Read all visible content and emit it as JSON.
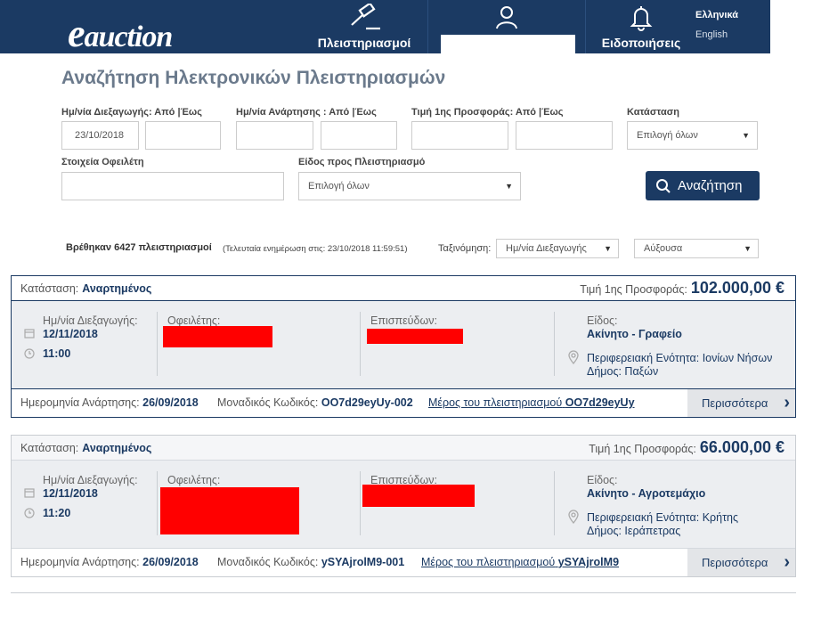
{
  "header": {
    "logo": "eauction",
    "logo_e": "e",
    "logo_rest": "auction",
    "nav_auctions": "Πλειστηριασμοί",
    "nav_notifications": "Ειδοποιήσεις",
    "lang_el": "Ελληνικά",
    "lang_en": "English",
    "icons": [
      "gavel-icon",
      "user-icon",
      "bell-icon"
    ]
  },
  "search": {
    "title": "Αναζήτηση Ηλεκτρονικών Πλειστηριασμών",
    "label_auction_date": "Ημ/νία Διεξαγωγής: Από |Έως",
    "auction_date_from": "23/10/2018",
    "auction_date_to": "",
    "label_post_date": "Ημ/νία Ανάρτησης : Από |Έως",
    "post_date_from": "",
    "post_date_to": "",
    "label_first_offer": "Τιμή 1ης Προσφοράς: Από |Έως",
    "first_offer_from": "",
    "first_offer_to": "",
    "label_status": "Κατάσταση",
    "status_value": "Επιλογή όλων",
    "label_debtor": "Στοιχεία Οφειλέτη",
    "debtor_value": "",
    "label_kind": "Είδος προς Πλειστηριασμό",
    "kind_value": "Επιλογή όλων",
    "search_button": "Αναζήτηση"
  },
  "results": {
    "found": "Βρέθηκαν 6427 πλειστηριασμοί",
    "updated": "(Τελευταία ενημέρωση στις: 23/10/2018 11:59:51)",
    "sort_label": "Ταξινόμηση:",
    "sort_by": "Ημ/νία Διεξαγωγής",
    "sort_order": "Αύξουσα"
  },
  "labels": {
    "status": "Κατάσταση:",
    "first_offer": "Τιμή 1ης Προσφοράς:",
    "auction_date": "Ημ/νία Διεξαγωγής:",
    "debtor": "Οφειλέτης:",
    "pursuer": "Επισπεύδων:",
    "kind": "Είδος:",
    "post_date": "Ημερομηνία Ανάρτησης:",
    "unique_code": "Μοναδικός Κωδικός:",
    "part_of": "Μέρος του πλειστηριασμού",
    "more": "Περισσότερα"
  },
  "cards": [
    {
      "status": "Αναρτημένος",
      "price": "102.000,00 €",
      "date": "12/11/2018",
      "time": "11:00",
      "kind": "Ακίνητο - Γραφείο",
      "region": "Περιφερειακή Ενότητα: Ιονίων Νήσων",
      "municipality": "Δήμος: Παξών",
      "post_date": "26/09/2018",
      "code": "OO7d29eyUy-002",
      "parent_code": "OO7d29eyUy"
    },
    {
      "status": "Αναρτημένος",
      "price": "66.000,00 €",
      "date": "12/11/2018",
      "time": "11:20",
      "kind": "Ακίνητο - Αγροτεμάχιο",
      "region": "Περιφερειακή Ενότητα: Κρήτης",
      "municipality": "Δήμος: Ιεράπετρας",
      "post_date": "26/09/2018",
      "code": "ySYAjrolM9-001",
      "parent_code": "ySYAjrolM9"
    }
  ],
  "colors": {
    "primary": "#1b3a63",
    "redaction": "#ff0000"
  }
}
